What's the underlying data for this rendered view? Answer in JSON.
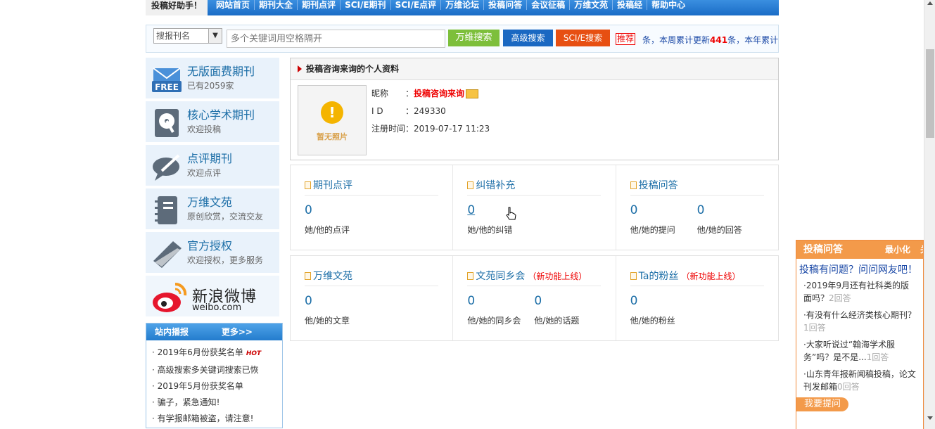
{
  "topnav": {
    "brand": "投稿好助手！",
    "items": [
      "网站首页",
      "期刊大全",
      "期刊点评",
      "SCI/E期刊",
      "SCI/E点评",
      "万维论坛",
      "投稿问答",
      "会议征稿",
      "万维文苑",
      "投稿经",
      "帮助中心"
    ]
  },
  "search": {
    "type_value": "搜报刊名",
    "placeholder": "多个关键词用空格隔开",
    "btn_wanwei": "万维搜索",
    "btn_adv": "高级搜索",
    "btn_sci": "SCI/E搜索",
    "tag_recommend": "推荐",
    "stats_prefix": "条，本周累计更新",
    "stats_num": "441",
    "stats_suffix": "条，本年累计"
  },
  "sidebar": {
    "items": [
      {
        "title": "无版面费期刊",
        "sub": "已有2059家",
        "icon": "free-mail-icon"
      },
      {
        "title": "核心学术期刊",
        "sub": "欢迎投稿",
        "icon": "disk-icon"
      },
      {
        "title": "点评期刊",
        "sub": "欢迎点评",
        "icon": "comment-pen-icon"
      },
      {
        "title": "万维文苑",
        "sub": "原创欣赏，交流交友",
        "icon": "notebook-icon"
      },
      {
        "title": "官方授权",
        "sub": "欢迎授权，更多服务",
        "icon": "book-icon"
      }
    ],
    "weibo_cn": "新浪微博",
    "weibo_en": "weibo.com"
  },
  "news": {
    "title": "站内播报",
    "more": "更多>>",
    "items": [
      "2019年6月份获奖名单",
      "高级搜索多关键词搜索已恢",
      "2019年5月份获奖名单",
      "骗子，紧急通知!",
      "有学报邮箱被盗，请注意!"
    ],
    "hot": "HOT"
  },
  "profile": {
    "header": "投稿咨询来询的个人资料",
    "photo_text": "暂无照片",
    "nick_label": "昵称",
    "nick": "投稿咨询来询",
    "id_label": "I D",
    "id": "249330",
    "reg_label": "注册时间",
    "reg": "2019-07-17 11:23"
  },
  "grid1": [
    {
      "title": "期刊点评",
      "metrics": [
        {
          "val": "0",
          "lab": "她/他的点评"
        }
      ]
    },
    {
      "title": "纠错补充",
      "metrics": [
        {
          "val": "0",
          "lab": "她/他的纠错"
        }
      ]
    },
    {
      "title": "投稿问答",
      "metrics": [
        {
          "val": "0",
          "lab": "他/她的提问"
        },
        {
          "val": "0",
          "lab": "他/她的回答"
        }
      ]
    }
  ],
  "grid2": [
    {
      "title": "万维文苑",
      "metrics": [
        {
          "val": "0",
          "lab": "他/她的文章"
        }
      ]
    },
    {
      "title": "文苑同乡会",
      "newfn": "（新功能上线）",
      "metrics": [
        {
          "val": "0",
          "lab": "他/她的同乡会"
        },
        {
          "val": "0",
          "lab": "他/她的话题"
        }
      ]
    },
    {
      "title": "Ta的粉丝",
      "newfn": "（新功能上线）",
      "metrics": [
        {
          "val": "0",
          "lab": "他/她的粉丝"
        }
      ]
    }
  ],
  "qa": {
    "title": "投稿问答",
    "minimize": "最小化",
    "close": "关",
    "prompt": "投稿有问题？问问网友吧！",
    "items": [
      {
        "q": "·2019年9月还有社科类的版面吗？",
        "cnt": "2回答"
      },
      {
        "q": "·有没有什么经济类核心期刊？",
        "cnt": "1回答"
      },
      {
        "q": "·大家听说过“翰海学术服务”吗？是不是...",
        "cnt": "1回答"
      },
      {
        "q": "·山东青年报新闻稿投稿，论文刊发邮箱",
        "cnt": "0回答"
      }
    ],
    "ask": "我要提问"
  },
  "colors": {
    "nav_blue": "#1a6cc6",
    "link_blue": "#1c6ea7",
    "accent_orange": "#f39a4a",
    "red": "#e00000"
  }
}
